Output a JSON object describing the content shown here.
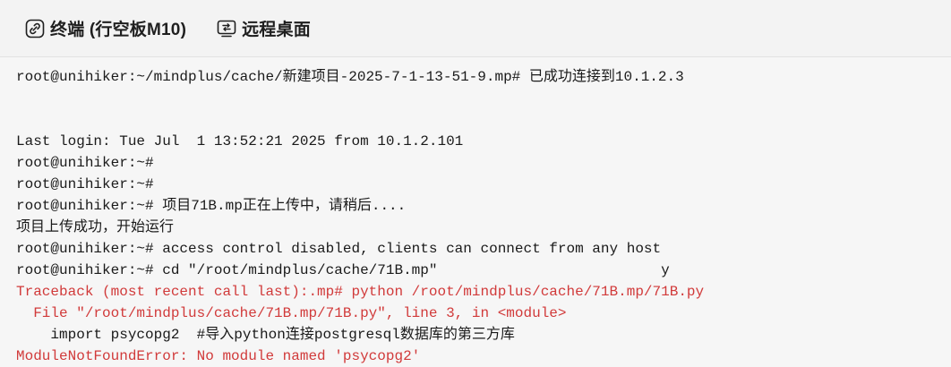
{
  "tabs": [
    {
      "label": "终端 (行空板M10)",
      "icon": "link-icon"
    },
    {
      "label": "远程桌面",
      "icon": "remote-desktop-icon"
    }
  ],
  "terminal": {
    "lines": [
      {
        "text": "root@unihiker:~/mindplus/cache/新建项目-2025-7-1-13-51-9.mp# 已成功连接到10.1.2.3",
        "kind": "normal"
      },
      {
        "text": "",
        "kind": "blank"
      },
      {
        "text": "",
        "kind": "blank"
      },
      {
        "text": "Last login: Tue Jul  1 13:52:21 2025 from 10.1.2.101",
        "kind": "normal"
      },
      {
        "text": "root@unihiker:~#",
        "kind": "normal"
      },
      {
        "text": "root@unihiker:~#",
        "kind": "normal"
      },
      {
        "text": "root@unihiker:~# 项目71B.mp正在上传中，请稍后....",
        "kind": "normal"
      },
      {
        "text": "项目上传成功，开始运行",
        "kind": "normal"
      },
      {
        "text": "root@unihiker:~# access control disabled, clients can connect from any host",
        "kind": "normal"
      },
      {
        "text": "root@unihiker:~# cd \"/root/mindplus/cache/71B.mp\"                          y",
        "kind": "normal"
      },
      {
        "text": "Traceback (most recent call last):.mp# python /root/mindplus/cache/71B.mp/71B.py",
        "kind": "error"
      },
      {
        "text": "  File \"/root/mindplus/cache/71B.mp/71B.py\", line 3, in <module>",
        "kind": "error"
      },
      {
        "text": "    import psycopg2  #导入python连接postgresql数据库的第三方库",
        "kind": "normal"
      },
      {
        "text": "ModuleNotFoundError: No module named 'psycopg2'",
        "kind": "error"
      }
    ]
  },
  "colors": {
    "tabbar_bg": "#f3f3f3",
    "terminal_bg": "#f6f6f6",
    "text": "#1a1a1a",
    "error": "#d13a3a"
  }
}
